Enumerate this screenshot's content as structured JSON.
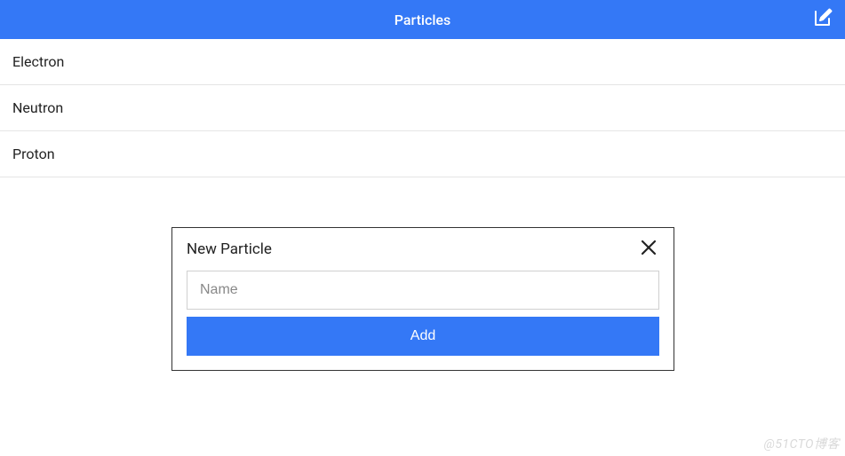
{
  "header": {
    "title": "Particles"
  },
  "list": {
    "items": [
      {
        "label": "Electron"
      },
      {
        "label": "Neutron"
      },
      {
        "label": "Proton"
      }
    ]
  },
  "dialog": {
    "title": "New Particle",
    "name_placeholder": "Name",
    "name_value": "",
    "add_label": "Add"
  },
  "watermark": "@51CTO博客"
}
